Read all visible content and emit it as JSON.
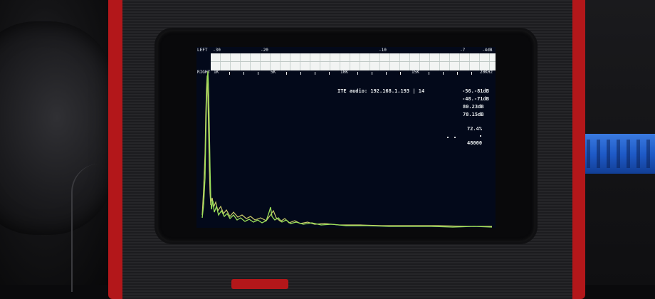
{
  "screen": {
    "channels": {
      "left": "LEFT",
      "right": "RIGHT"
    },
    "db_scale": [
      "-30",
      "-20",
      "-10",
      "-7",
      "-4dB"
    ],
    "freq_scale": [
      "1K",
      "5K",
      "10K",
      "15K",
      "20KHz"
    ],
    "status_line": "ITE audio: 192.168.1.193 | 14",
    "readouts": [
      "-56.-81dB",
      "-48.-71dB",
      "80.23dB",
      "78.15dB"
    ],
    "level_percent": "72.4%",
    "sample_rate": "48000",
    "colors": {
      "trace_green": "#9be15a",
      "trace_yellow": "#f0f07a",
      "screen_bg": "#03091a"
    }
  }
}
